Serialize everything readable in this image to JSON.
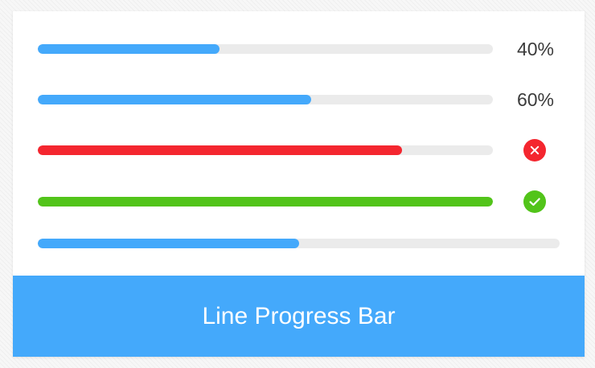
{
  "colors": {
    "blue": "#44a9fb",
    "red": "#f4262f",
    "green": "#52c41a",
    "track": "#ebebeb"
  },
  "progress_bars": [
    {
      "percent": 40,
      "label": "40%",
      "status": "normal",
      "color": "#44a9fb"
    },
    {
      "percent": 60,
      "label": "60%",
      "status": "normal",
      "color": "#44a9fb"
    },
    {
      "percent": 80,
      "status": "exception",
      "icon": "close-circle-icon",
      "color": "#f4262f"
    },
    {
      "percent": 100,
      "status": "success",
      "icon": "check-circle-icon",
      "color": "#52c41a"
    },
    {
      "percent": 50,
      "status": "normal",
      "show_info": false,
      "color": "#44a9fb"
    }
  ],
  "footer": {
    "title": "Line Progress Bar"
  }
}
